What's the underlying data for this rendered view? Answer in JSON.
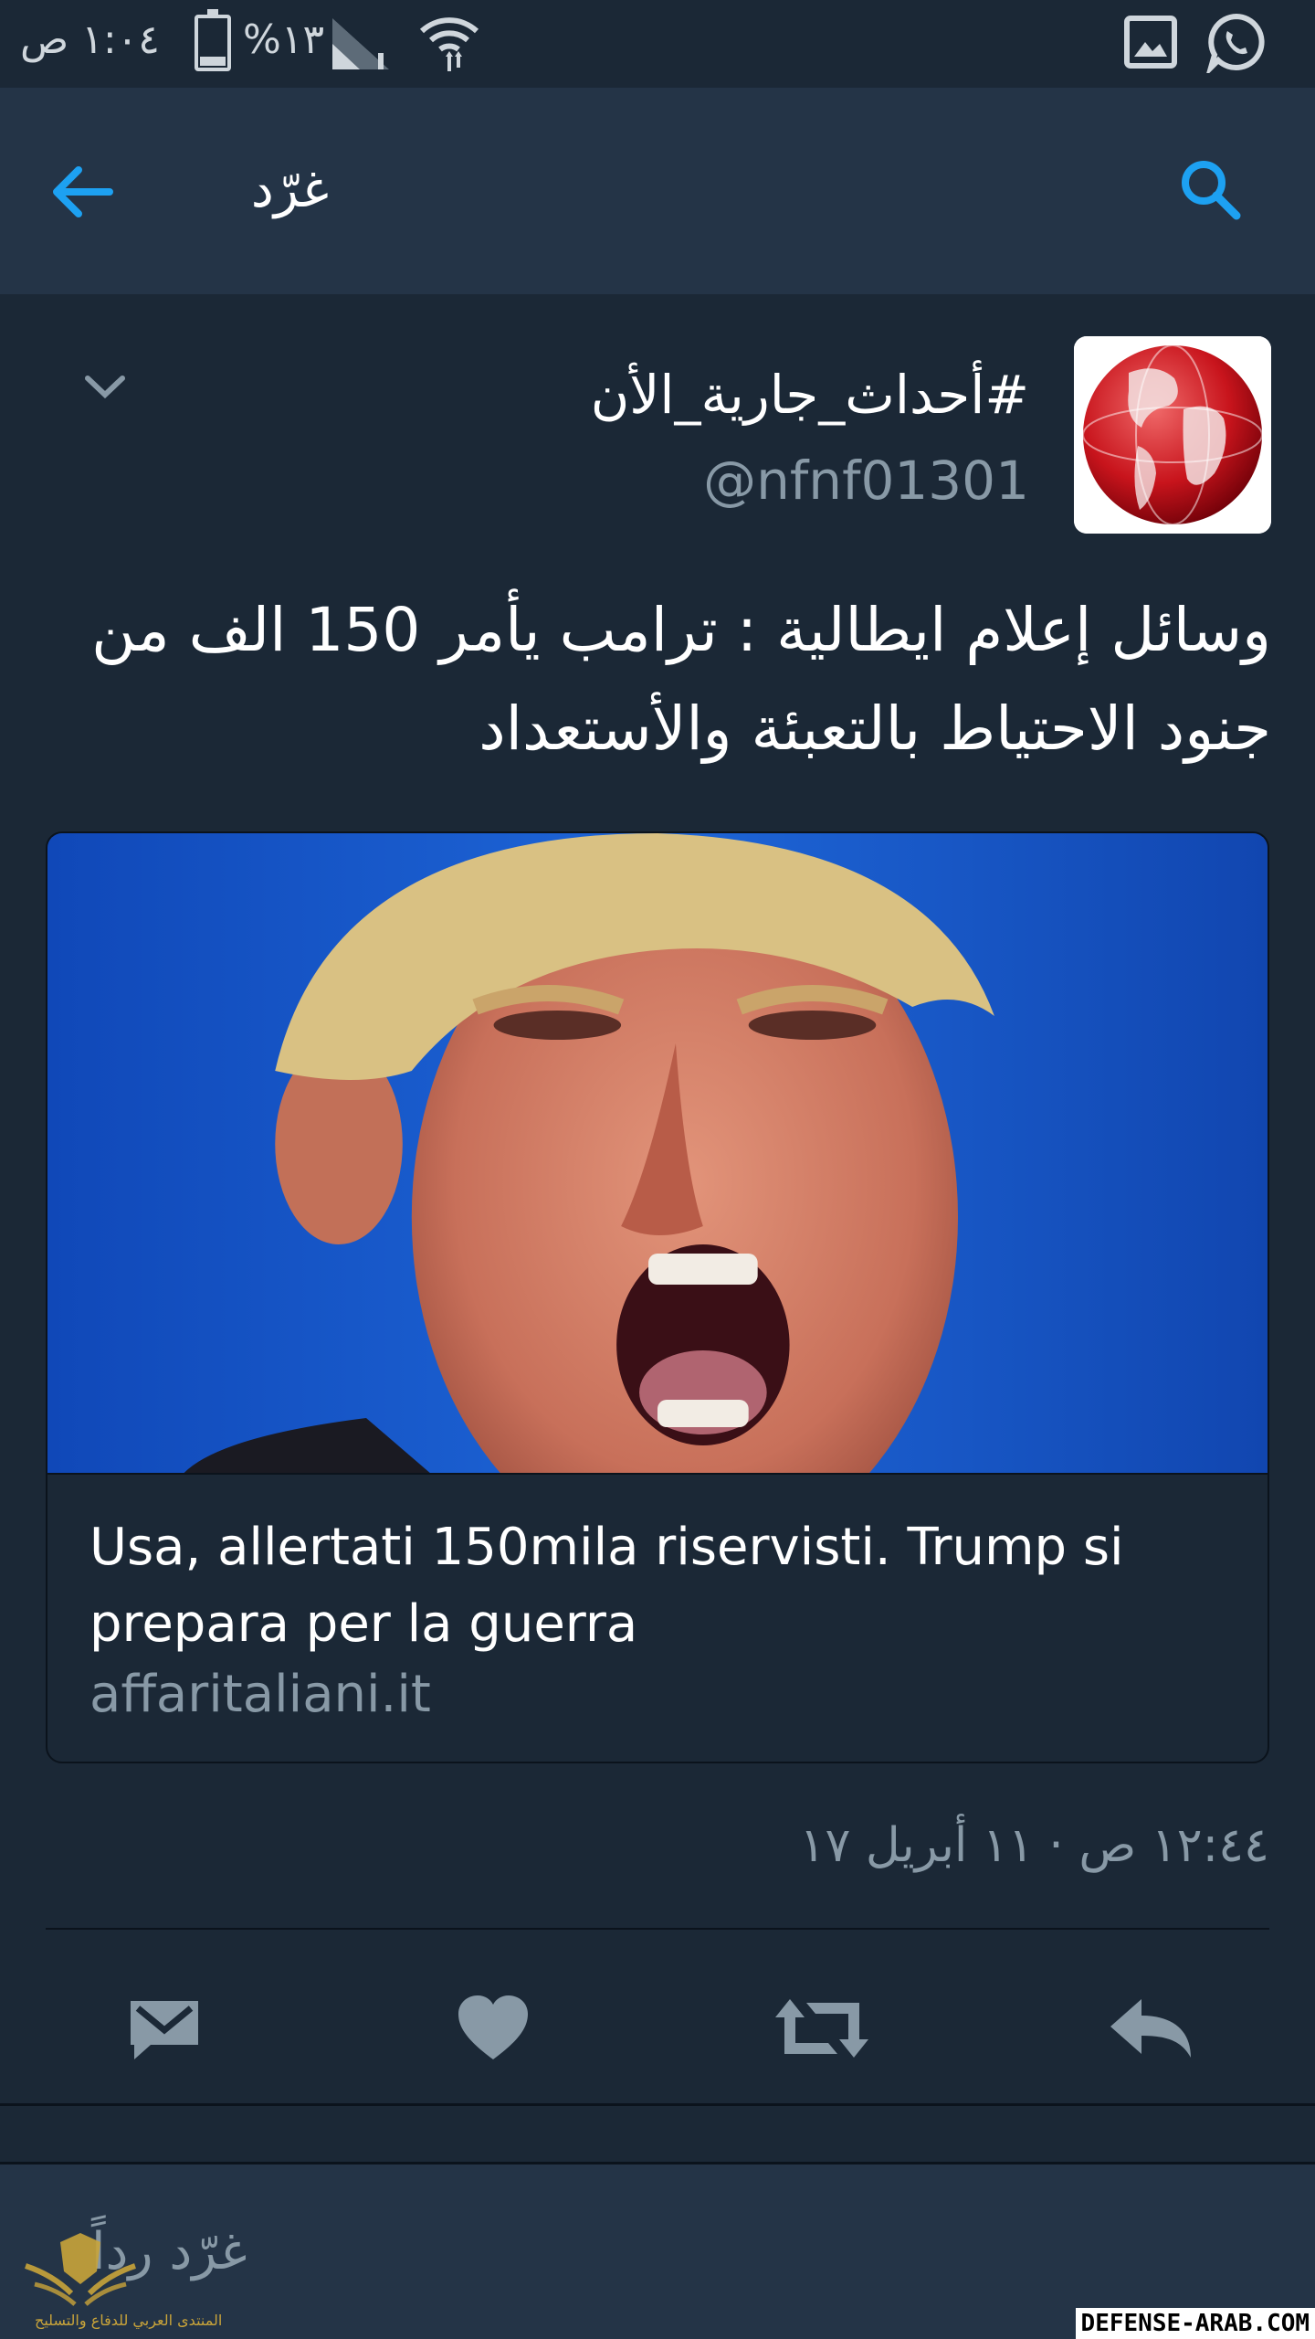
{
  "status_bar": {
    "time": "١:٠٤ ص",
    "battery": "%١٣",
    "icons": [
      "wifi-icon",
      "signal-icon",
      "battery-icon",
      "gallery-icon",
      "whatsapp-icon"
    ]
  },
  "toolbar": {
    "title": "غرّد",
    "back_icon": "back-arrow-icon",
    "search_icon": "search-icon"
  },
  "tweet": {
    "display_name": "#أحداث_جارية_الأن",
    "handle": "@nfnf01301",
    "text": "وسائل إعلام ايطالية : ترامب يأمر 150 الف من جنود الاحتياط بالتعبئة والأستعداد",
    "card": {
      "title": "Usa, allertati 150mila riservisti. Trump si prepara per la guerra",
      "domain": "affaritaliani.it"
    },
    "timestamp": "١٢:٤٤ ص · ١١ أبريل ١٧"
  },
  "actions": [
    "message-icon",
    "like-icon",
    "retweet-icon",
    "reply-icon"
  ],
  "composer": {
    "placeholder": "غرّد رداً"
  },
  "watermark": {
    "text": "DEFENSE-ARAB.COM",
    "logo_caption": "المنتدى العربي للدفاع والتسليح"
  },
  "colors": {
    "background": "#1b2836",
    "toolbar": "#243447",
    "accent": "#1da1f2",
    "muted": "#8899a6",
    "icon": "#8899a6"
  }
}
